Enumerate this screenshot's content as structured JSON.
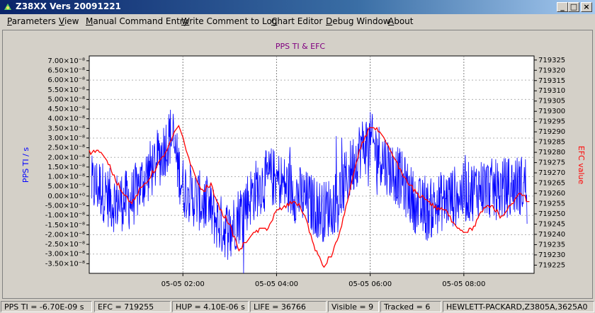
{
  "window": {
    "title": "Z38XX Vers 20091221",
    "minimize": "_",
    "maximize": "□",
    "close": "×"
  },
  "menu": [
    "Parameters",
    "View",
    "Manual Command Entry",
    "Write Comment to Log",
    "Chart Editor",
    "Debug Window",
    "About"
  ],
  "colors": {
    "tiSeries": "#0000ff",
    "efcSeries": "#ff0000",
    "title": "#800080",
    "plotBg": "#ffffff"
  },
  "chart_data": {
    "type": "line",
    "title": "PPS TI & EFC",
    "ylabel_left": "PPS TI / s",
    "ylabel_right": "EFC value",
    "x_ticks": [
      "05-05 02:00",
      "05-05 04:00",
      "05-05 06:00",
      "05-05 08:00"
    ],
    "x_range_hours": [
      0.0,
      9.5
    ],
    "x_tick_hours": [
      2,
      4,
      6,
      8
    ],
    "y_left_ticks": [
      "7.00×10⁻⁸",
      "6.50×10⁻⁸",
      "6.00×10⁻⁸",
      "5.50×10⁻⁸",
      "5.00×10⁻⁸",
      "4.50×10⁻⁸",
      "4.00×10⁻⁸",
      "3.50×10⁻⁸",
      "3.00×10⁻⁸",
      "2.50×10⁻⁸",
      "2.00×10⁻⁸",
      "1.50×10⁻⁸",
      "1.00×10⁻⁸",
      "5.00×10⁻⁹",
      "0.00×10⁺⁰",
      "-5.00×10⁻⁹",
      "-1.00×10⁻⁸",
      "-1.50×10⁻⁸",
      "-2.00×10⁻⁸",
      "-2.50×10⁻⁸",
      "-3.00×10⁻⁸",
      "-3.50×10⁻⁸"
    ],
    "y_left_range": [
      -4e-08,
      7.25e-08
    ],
    "y_right_ticks": [
      "719325",
      "719320",
      "719315",
      "719310",
      "719305",
      "719300",
      "719295",
      "719290",
      "719285",
      "719280",
      "719275",
      "719270",
      "719265",
      "719260",
      "719255",
      "719250",
      "719245",
      "719240",
      "719235",
      "719230",
      "719225"
    ],
    "y_right_range": [
      719221,
      719327
    ],
    "series": [
      {
        "name": "PPS TI",
        "axis": "left",
        "hours": [
          0.2,
          0.5,
          0.9,
          1.2,
          1.5,
          1.75,
          1.9,
          2.0,
          2.2,
          2.5,
          2.8,
          3.0,
          3.3,
          3.6,
          3.9,
          4.2,
          4.5,
          4.8,
          5.0,
          5.3,
          5.6,
          5.8,
          6.0,
          6.2,
          6.4,
          6.6,
          6.8,
          7.0,
          7.2,
          7.5,
          7.8,
          8.1,
          8.4,
          8.7,
          9.0,
          9.3
        ],
        "values": [
          5e-09,
          -3e-09,
          -2e-09,
          1e-08,
          2e-08,
          3.2e-08,
          1.5e-08,
          5e-09,
          0.0,
          -5e-09,
          -1.5e-08,
          -1.8e-08,
          -5e-09,
          5e-09,
          1e-08,
          5e-09,
          0.0,
          -5e-09,
          -8e-09,
          -2e-09,
          1.5e-08,
          2.5e-08,
          2.8e-08,
          2.2e-08,
          1.5e-08,
          1e-08,
          3e-09,
          -5e-09,
          -8e-09,
          -3e-09,
          0.0,
          2e-09,
          5e-09,
          3e-09,
          5e-09,
          6e-09
        ]
      },
      {
        "name": "EFC",
        "axis": "right",
        "hours": [
          0.0,
          0.2,
          0.4,
          0.6,
          0.9,
          1.1,
          1.3,
          1.5,
          1.7,
          1.9,
          2.0,
          2.2,
          2.4,
          2.6,
          2.8,
          3.0,
          3.2,
          3.4,
          3.6,
          3.8,
          4.0,
          4.2,
          4.4,
          4.6,
          4.8,
          5.0,
          5.2,
          5.4,
          5.6,
          5.8,
          6.0,
          6.2,
          6.4,
          6.6,
          6.8,
          7.0,
          7.2,
          7.4,
          7.6,
          7.8,
          8.0,
          8.2,
          8.4,
          8.6,
          8.8,
          9.0,
          9.2,
          9.4
        ],
        "values": [
          719280,
          719281,
          719275,
          719265,
          719255,
          719262,
          719268,
          719275,
          719283,
          719293,
          719287,
          719272,
          719261,
          719264,
          719252,
          719245,
          719232,
          719238,
          719242,
          719243,
          719251,
          719254,
          719256,
          719250,
          719234,
          719224,
          719231,
          719245,
          719265,
          719283,
          719293,
          719290,
          719282,
          719273,
          719265,
          719260,
          719257,
          719253,
          719252,
          719245,
          719241,
          719243,
          719252,
          719254,
          719248,
          719254,
          719260,
          719256
        ]
      }
    ]
  },
  "status": {
    "pps_ti": "PPS TI = -6.70E-09 s",
    "efc": "EFC = 719255",
    "hup": "HUP = 4.10E-06 s",
    "life": "LIFE = 36766",
    "visible": "Visible = 9",
    "tracked": "Tracked = 6",
    "device": "HEWLETT-PACKARD,Z3805A,3625A0"
  }
}
